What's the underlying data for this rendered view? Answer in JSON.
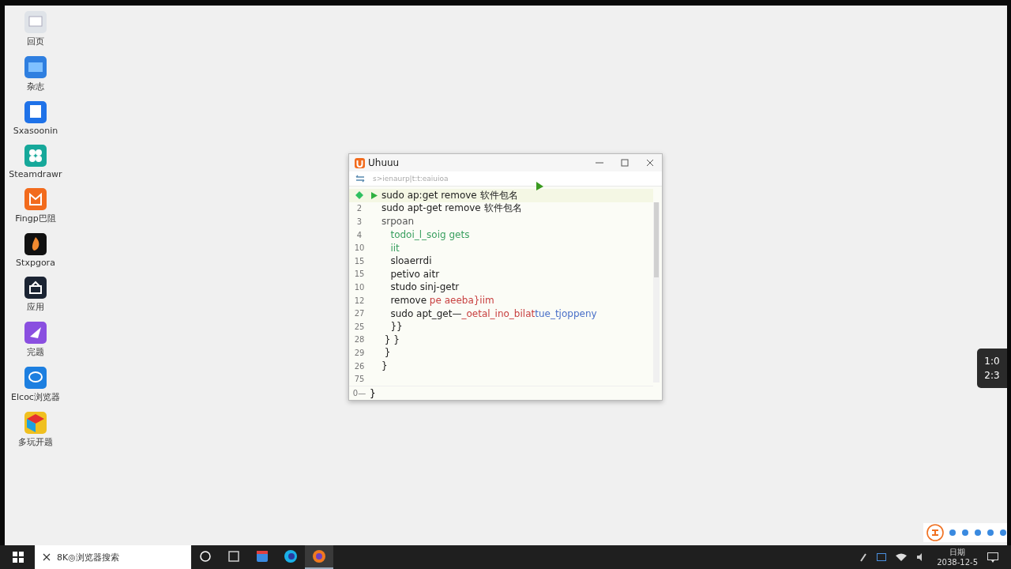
{
  "desktop_icons": [
    {
      "label": "回页",
      "kind": "monitor"
    },
    {
      "label": "杂志",
      "kind": "folder"
    },
    {
      "label": "Sxasoonin",
      "kind": "note"
    },
    {
      "label": "Steamdrawr",
      "kind": "grid"
    },
    {
      "label": "Fingp巴阻",
      "kind": "bag"
    },
    {
      "label": "Stxpgora",
      "kind": "flame"
    },
    {
      "label": "应用",
      "kind": "store"
    },
    {
      "label": "完题",
      "kind": "paper"
    },
    {
      "label": "Elcoc浏览器",
      "kind": "chat"
    },
    {
      "label": "多玩开题",
      "kind": "cube"
    }
  ],
  "window": {
    "title": "Uhuuu",
    "path": "s>ienaurp|t:t:eaiuioa",
    "lines": [
      {
        "breakpoint": true,
        "run": true,
        "parts": [
          {
            "text": "sudo ap:get remove 软件包名",
            "color": "#222222"
          }
        ]
      },
      {
        "number": "2",
        "breakpoint": false,
        "run": false,
        "parts": [
          {
            "text": "sudo apt-get remove 软件包名",
            "color": "#222222"
          }
        ]
      },
      {
        "number": "3",
        "breakpoint": false,
        "run": false,
        "parts": [
          {
            "text": "srpoan",
            "color": "#555555"
          }
        ]
      },
      {
        "number": "4",
        "breakpoint": false,
        "run": false,
        "parts": [
          {
            "text": "   todoi_l_soig gets",
            "color": "#3aa060"
          }
        ]
      },
      {
        "number": "10",
        "breakpoint": false,
        "run": false,
        "parts": [
          {
            "text": "   iit",
            "color": "#3aa060"
          }
        ]
      },
      {
        "number": "15",
        "breakpoint": false,
        "run": false,
        "parts": [
          {
            "text": "   sloaerrdi",
            "color": "#222222"
          }
        ]
      },
      {
        "number": "15",
        "breakpoint": false,
        "run": false,
        "parts": [
          {
            "text": "   petivo aitr",
            "color": "#222222"
          }
        ]
      },
      {
        "number": "10",
        "breakpoint": false,
        "run": false,
        "parts": [
          {
            "text": "   studo sinj-getr",
            "color": "#222222"
          }
        ]
      },
      {
        "number": "12",
        "breakpoint": false,
        "run": false,
        "parts": [
          {
            "text": "   remove",
            "color": "#222222"
          },
          {
            "text": " pe aeeba}iim",
            "color": "#c84040"
          }
        ]
      },
      {
        "number": "27",
        "breakpoint": false,
        "run": false,
        "parts": [
          {
            "text": "   sudo apt_get—",
            "color": "#222222"
          },
          {
            "text": "_oetal_ino_bilat",
            "color": "#c84040"
          },
          {
            "text": "tue_tjoppeny",
            "color": "#4a70c8"
          }
        ]
      },
      {
        "number": "25",
        "breakpoint": false,
        "run": false,
        "parts": [
          {
            "text": "   }}",
            "color": "#222222"
          }
        ]
      },
      {
        "number": "28",
        "breakpoint": false,
        "run": false,
        "parts": [
          {
            "text": " } }",
            "color": "#222222"
          }
        ]
      },
      {
        "number": "29",
        "breakpoint": false,
        "run": false,
        "parts": [
          {
            "text": " }",
            "color": "#222222"
          }
        ]
      },
      {
        "number": "26",
        "breakpoint": false,
        "run": false,
        "parts": [
          {
            "text": "}",
            "color": "#222222"
          }
        ]
      },
      {
        "number": "75",
        "breakpoint": false,
        "run": false
      }
    ],
    "footer": {
      "number": "0—",
      "text": "}"
    }
  },
  "clock_widget": [
    "1:0",
    "2:3"
  ],
  "taskbar": {
    "search": "8K◎浏览器搜索",
    "apps": [
      {
        "kind": "circle",
        "selected": false
      },
      {
        "kind": "taskview",
        "selected": false
      },
      {
        "kind": "calendar",
        "selected": false
      },
      {
        "kind": "orb",
        "selected": false
      },
      {
        "kind": "fox",
        "selected": true
      }
    ],
    "time": "日期",
    "date": "2038-12-5"
  }
}
